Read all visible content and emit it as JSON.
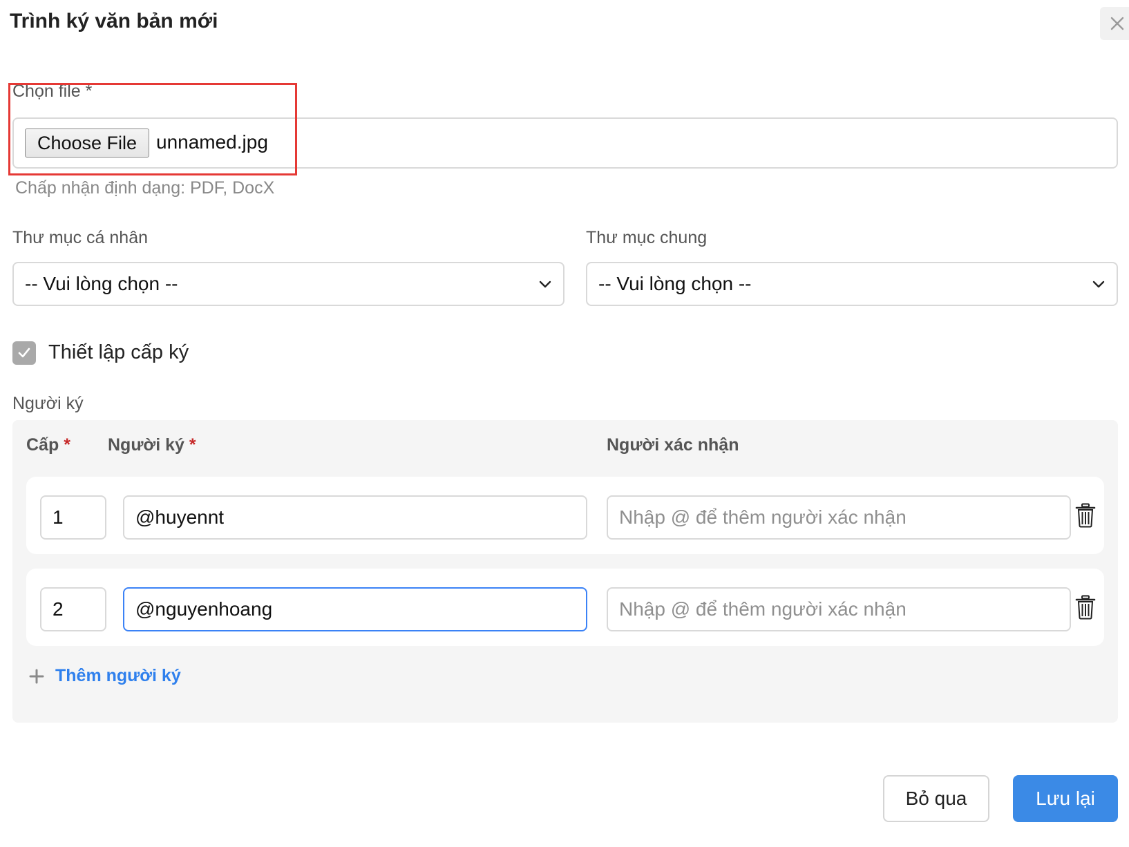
{
  "dialog": {
    "title": "Trình ký văn bản mới"
  },
  "file": {
    "label": "Chọn file",
    "required_mark": "*",
    "button_label": "Choose File",
    "file_name": "unnamed.jpg",
    "hint": "Chấp nhận định dạng: PDF, DocX"
  },
  "personal_folder": {
    "label": "Thư mục cá nhân",
    "value": "-- Vui lòng chọn --"
  },
  "shared_folder": {
    "label": "Thư mục chung",
    "value": "-- Vui lòng chọn --"
  },
  "signing_levels": {
    "label": "Thiết lập cấp ký",
    "checked": true
  },
  "signers": {
    "section_label": "Người ký",
    "columns": {
      "level": "Cấp",
      "signer": "Người ký",
      "confirmer": "Người xác nhận",
      "required_mark": "*"
    },
    "rows": [
      {
        "level": "1",
        "signer": "@huyennt",
        "confirmer_placeholder": "Nhập @ để thêm người xác nhận"
      },
      {
        "level": "2",
        "signer": "@nguyenhoang",
        "confirmer_placeholder": "Nhập @ để thêm người xác nhận"
      }
    ],
    "add_label": "Thêm người ký"
  },
  "footer": {
    "cancel_label": "Bỏ qua",
    "save_label": "Lưu lại"
  },
  "colors": {
    "accent": "#3b8ae6",
    "link": "#2f80ed",
    "required": "#c62828",
    "highlight": "#e53935"
  }
}
